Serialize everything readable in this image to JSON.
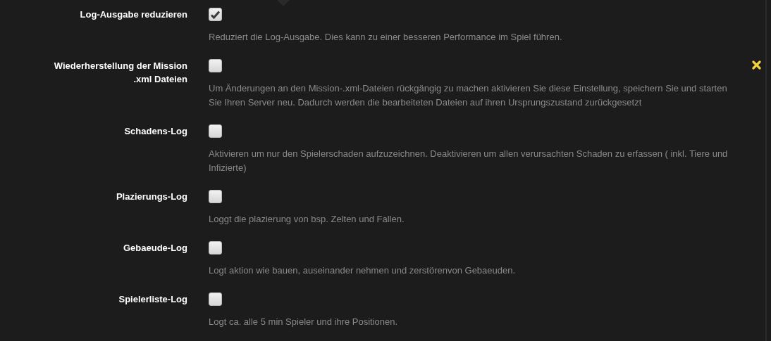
{
  "settings": [
    {
      "label": "Log-Ausgabe reduzieren",
      "checked": true,
      "changed": false,
      "description": "Reduziert die Log-Ausgabe. Dies kann zu einer besseren Performance im Spiel führen."
    },
    {
      "label": "Wiederherstellung der Mission .xml Dateien",
      "checked": false,
      "changed": true,
      "description": "Um Änderungen an den Mission-.xml-Dateien rückgängig zu machen aktivieren Sie diese Einstellung, speichern Sie und starten Sie Ihren Server neu. Dadurch werden die bearbeiteten Dateien auf ihren Ursprungszustand zurückgesetzt"
    },
    {
      "label": "Schadens-Log",
      "checked": false,
      "changed": false,
      "description": "Aktivieren um nur den Spielerschaden aufzuzeichnen. Deaktivieren um allen verursachten Schaden zu erfassen ( inkl. Tiere und Infizierte)"
    },
    {
      "label": "Plazierungs-Log",
      "checked": false,
      "changed": false,
      "description": "Loggt die plazierung von bsp. Zelten und Fallen."
    },
    {
      "label": "Gebaeude-Log",
      "checked": false,
      "changed": false,
      "description": "Logt aktion wie bauen, auseinander nehmen und zerstörenvon Gebaeuden."
    },
    {
      "label": "Spielerliste-Log",
      "checked": false,
      "changed": false,
      "description": "Logt ca. alle 5 min Spieler und ihre Positionen."
    }
  ]
}
